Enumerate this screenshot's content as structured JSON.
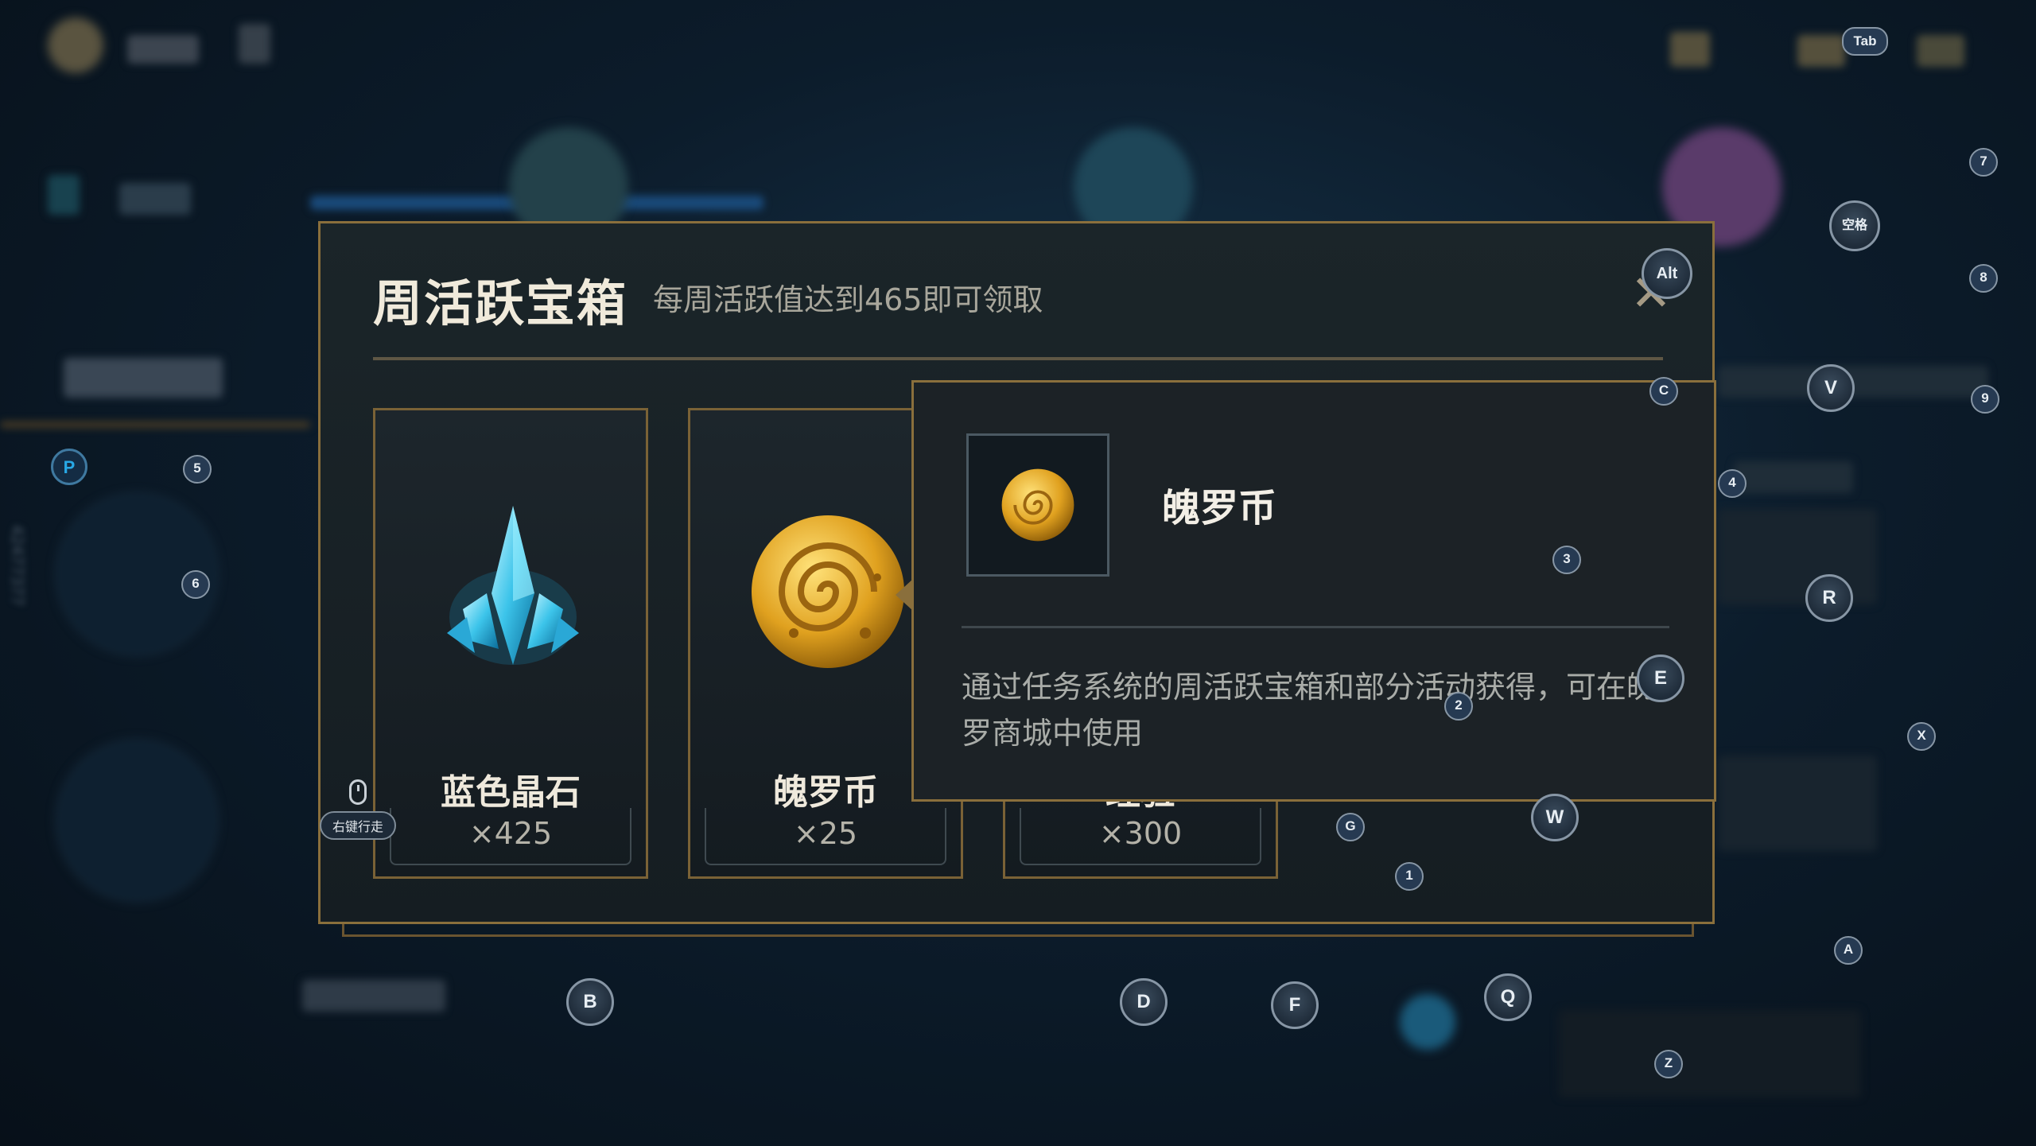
{
  "dialog": {
    "title": "周活跃宝箱",
    "subtitle": "每周活跃值达到465即可领取",
    "close_symbol": "✕"
  },
  "rewards": [
    {
      "name": "蓝色晶石",
      "qty": "×425",
      "icon": "blue-crystal-icon"
    },
    {
      "name": "魄罗币",
      "qty": "×25",
      "icon": "poro-coin-icon"
    },
    {
      "name": "经验",
      "qty": "×300",
      "icon": "exp-icon"
    }
  ],
  "tooltip": {
    "name": "魄罗币",
    "description": "通过任务系统的周活跃宝箱和部分活动获得，可在魄罗商城中使用",
    "icon": "poro-coin-icon"
  },
  "mouse_hint": {
    "label": "右键行走",
    "icon": "mouse-icon"
  },
  "hotkeys": {
    "tab": "Tab",
    "alt": "Alt",
    "space": "空格",
    "p": "P",
    "k1": "1",
    "k2": "2",
    "k3": "3",
    "k4": "4",
    "k5": "5",
    "k6": "6",
    "k7": "7",
    "k8": "8",
    "k9": "9",
    "a": "A",
    "b": "B",
    "c": "C",
    "d": "D",
    "e": "E",
    "f": "F",
    "g": "G",
    "q": "Q",
    "r": "R",
    "v": "V",
    "w": "W",
    "x": "X",
    "z": "Z"
  },
  "colors": {
    "gold_border": "#8a6f3c",
    "panel_bg": "#1b2529",
    "title": "#f0eadb"
  }
}
